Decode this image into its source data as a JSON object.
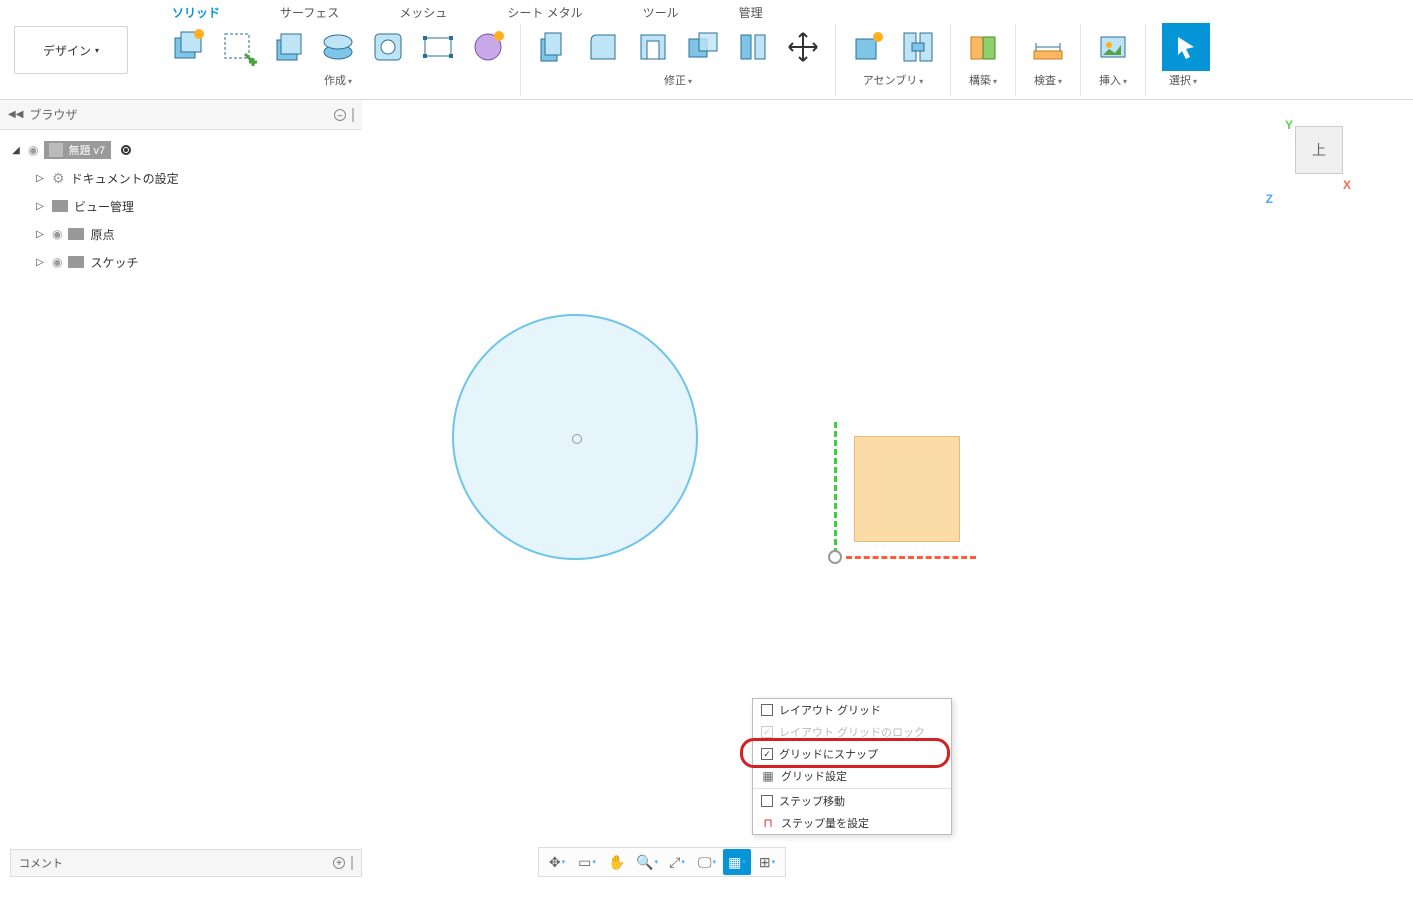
{
  "design_label": "デザイン",
  "tabs": [
    "ソリッド",
    "サーフェス",
    "メッシュ",
    "シート メタル",
    "ツール",
    "管理"
  ],
  "groups": {
    "create": "作成",
    "modify": "修正",
    "assemble": "アセンブリ",
    "construct": "構築",
    "inspect": "検査",
    "insert": "挿入",
    "select": "選択"
  },
  "browser": {
    "title": "ブラウザ",
    "root": "無題 v7",
    "items": [
      "ドキュメントの設定",
      "ビュー管理",
      "原点",
      "スケッチ"
    ]
  },
  "viewcube": "上",
  "axis": {
    "x": "X",
    "y": "Y",
    "z": "Z"
  },
  "popup": {
    "layout_grid": "レイアウト グリッド",
    "layout_lock": "レイアウト グリッドのロック",
    "snap": "グリッドにスナップ",
    "grid_settings": "グリッド設定",
    "step": "ステップ移動",
    "set_step": "ステップ量を設定"
  },
  "comments": "コメント"
}
